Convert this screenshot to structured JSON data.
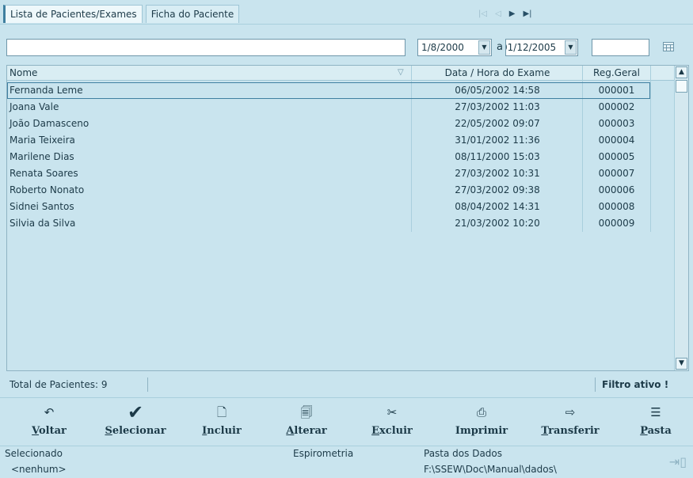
{
  "tabs": [
    {
      "label": "Lista de Pacientes/Exames",
      "active": true
    },
    {
      "label": "Ficha do Paciente",
      "active": false
    }
  ],
  "nav": {
    "first": "|◁",
    "prev": "◁",
    "next": "▶",
    "last": "▶|"
  },
  "filter": {
    "search_value": "",
    "date_from": "1/8/2000",
    "separator": "a",
    "date_to": "01/12/2005",
    "extra_value": "",
    "calendar_icon": "calendar-icon"
  },
  "table": {
    "columns": [
      "Nome",
      "Data / Hora do Exame",
      "Reg.Geral"
    ],
    "sort_icon": "▽",
    "rows": [
      {
        "nome": "Fernanda Leme",
        "data": "06/05/2002 14:58",
        "reg": "000001"
      },
      {
        "nome": "Joana Vale",
        "data": "27/03/2002 11:03",
        "reg": "000002"
      },
      {
        "nome": "João Damasceno",
        "data": "22/05/2002 09:07",
        "reg": "000003"
      },
      {
        "nome": "Maria Teixeira",
        "data": "31/01/2002 11:36",
        "reg": "000004"
      },
      {
        "nome": "Marilene Dias",
        "data": "08/11/2000 15:03",
        "reg": "000005"
      },
      {
        "nome": "Renata Soares",
        "data": "27/03/2002 10:31",
        "reg": "000007"
      },
      {
        "nome": "Roberto Nonato",
        "data": "27/03/2002 09:38",
        "reg": "000006"
      },
      {
        "nome": "Sidnei Santos",
        "data": "08/04/2002 14:31",
        "reg": "000008"
      },
      {
        "nome": "Silvia da Silva",
        "data": "21/03/2002 10:20",
        "reg": "000009"
      }
    ]
  },
  "status": {
    "total": "Total de Pacientes: 9",
    "filter": "Filtro ativo !"
  },
  "toolbar": [
    {
      "name": "voltar",
      "icon": "↶",
      "first": "V",
      "rest": "oltar"
    },
    {
      "name": "selecionar",
      "icon": "✔",
      "first": "S",
      "rest": "elecionar"
    },
    {
      "name": "incluir",
      "icon": "🗋",
      "first": "I",
      "rest": "ncluir"
    },
    {
      "name": "alterar",
      "icon": "🗐",
      "first": "A",
      "rest": "lterar"
    },
    {
      "name": "excluir",
      "icon": "✂",
      "first": "E",
      "rest": "xcluir"
    },
    {
      "name": "imprimir",
      "icon": "⎙",
      "first": "Imprimir",
      "rest": ""
    },
    {
      "name": "transferir",
      "icon": "⇨",
      "first": "T",
      "rest": "ransferir"
    },
    {
      "name": "pasta",
      "icon": "☰",
      "first": "P",
      "rest": "asta"
    }
  ],
  "info": {
    "selecionado_label": "Selecionado",
    "selecionado_value": "<nenhum>",
    "exame": "Espirometria",
    "pasta_label": "Pasta dos Dados",
    "pasta_value": "F:\\SSEW\\Doc\\Manual\\dados\\"
  },
  "colors": {
    "background": "#c9e4ee",
    "text": "#1c3a48",
    "border": "#8fb3c3",
    "accent": "#3f7fa0"
  }
}
